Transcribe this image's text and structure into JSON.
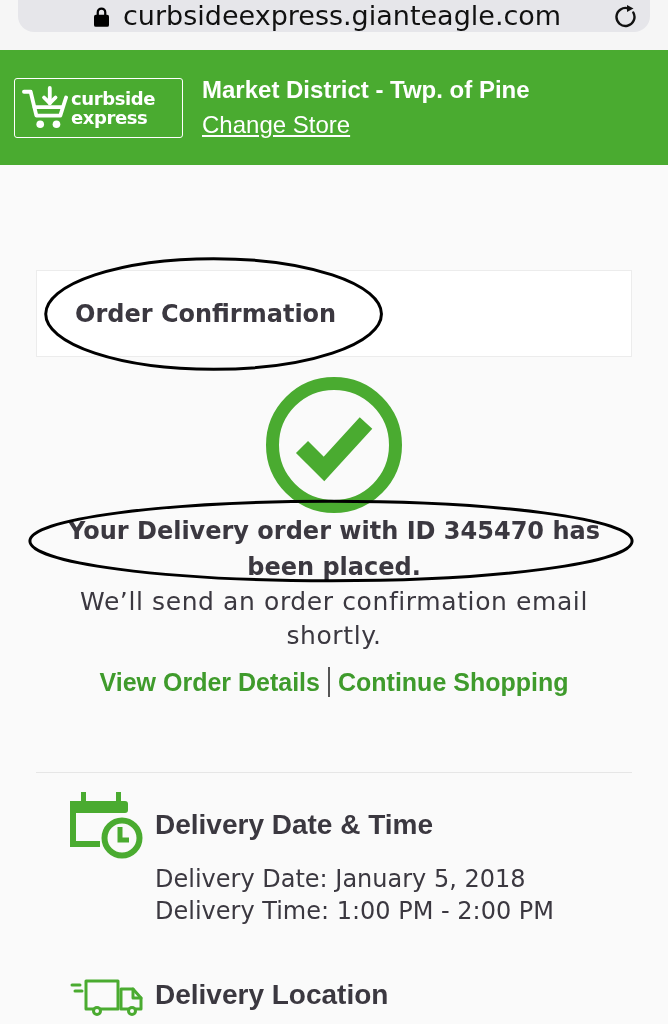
{
  "browser": {
    "url": "curbsideexpress.gianteagle.com"
  },
  "header": {
    "logo": [
      "curbside",
      "express"
    ],
    "store_name": "Market District - Twp. of Pine",
    "change_store": "Change Store"
  },
  "confirmation": {
    "title": {
      "text": "Order Confirmation",
      "circled": true
    },
    "message": {
      "text": "Your Delivery order with ID 345470 has been placed.",
      "circled": true
    },
    "note": "We’ll send an order confirmation email shortly.",
    "links": [
      "View Order Details",
      "Continue Shopping"
    ]
  },
  "sections": [
    {
      "kind": "date_time",
      "title": "Delivery Date & Time",
      "lines": [
        "Delivery Date: January 5, 2018",
        "Delivery Time: 1:00 PM - 2:00 PM"
      ]
    },
    {
      "kind": "location",
      "title": "Delivery Location"
    }
  ]
}
